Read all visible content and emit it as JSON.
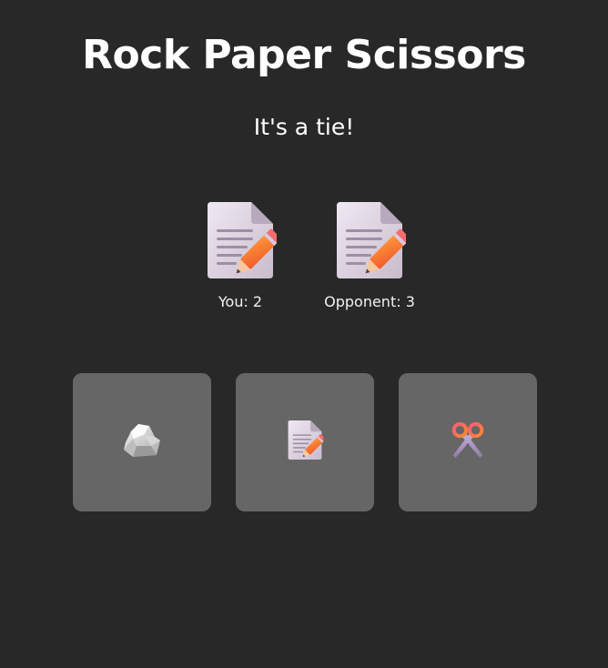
{
  "title": "Rock Paper Scissors",
  "result_text": "It's a tie!",
  "players": {
    "you": {
      "label": "You: 2",
      "choice_icon": "paper-pencil-icon"
    },
    "opponent": {
      "label": "Opponent: 3",
      "choice_icon": "paper-pencil-icon"
    }
  },
  "choices": [
    {
      "name": "rock",
      "icon": "rock-icon"
    },
    {
      "name": "paper",
      "icon": "paper-pencil-icon"
    },
    {
      "name": "scissors",
      "icon": "scissors-icon"
    }
  ],
  "colors": {
    "background": "#282828",
    "choice_tile": "#666666",
    "text": "#ffffff"
  }
}
